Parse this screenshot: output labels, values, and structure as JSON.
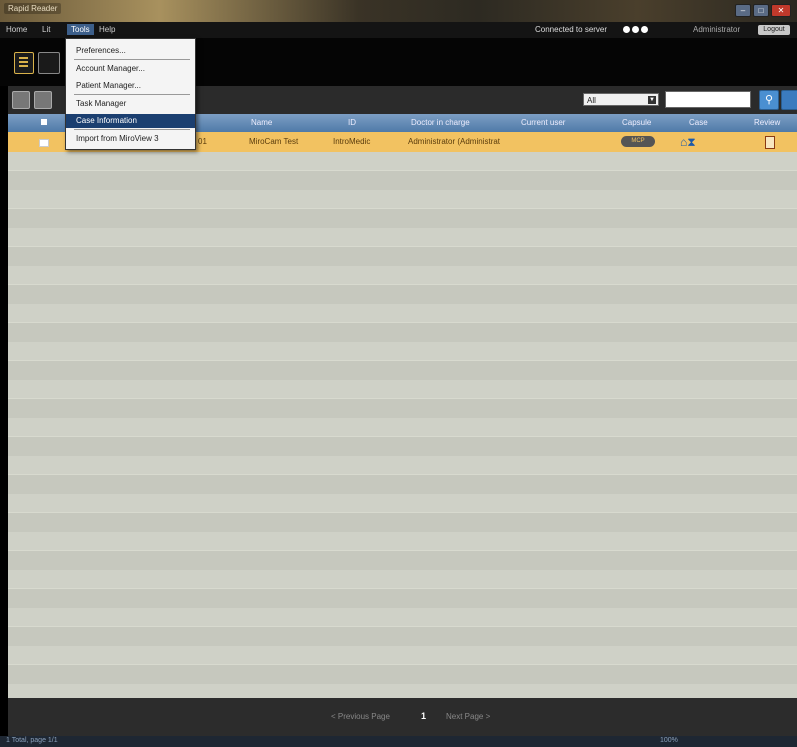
{
  "window": {
    "title": "Rapid Reader",
    "close_label": "✕",
    "min_label": "–",
    "max_label": "□"
  },
  "menubar": {
    "items": [
      "Home",
      "Lit",
      "Tools",
      "Help"
    ],
    "server_status": "Connected to server",
    "user": "Administrator",
    "logout": "Logout"
  },
  "tools_menu": {
    "items": [
      "Preferences...",
      "Account Manager...",
      "Patient Manager...",
      "Task Manager",
      "Case Information",
      "Import from MiroView 3"
    ]
  },
  "filter": {
    "selected": "All"
  },
  "table": {
    "columns": [
      "Name",
      "ID",
      "Doctor in charge",
      "Current user",
      "Capsule",
      "Case",
      "Review"
    ],
    "rows": [
      {
        "code": "01",
        "name": "MiroCam Test",
        "id": "IntroMedic",
        "doctor": "Administrator (Administrat",
        "current_user": "",
        "capsule": "MCP",
        "case_icons": "⌂⧗"
      }
    ]
  },
  "pagination": {
    "prev": "< Previous Page",
    "page": "1",
    "next": "Next Page >"
  },
  "status": {
    "left_text": "1 Total, page 1/1",
    "zoom": "100%"
  },
  "colors": {
    "header_blue": "#5f86b3",
    "selected_row": "#f2c261",
    "menu_highlight": "#1b3f70"
  }
}
